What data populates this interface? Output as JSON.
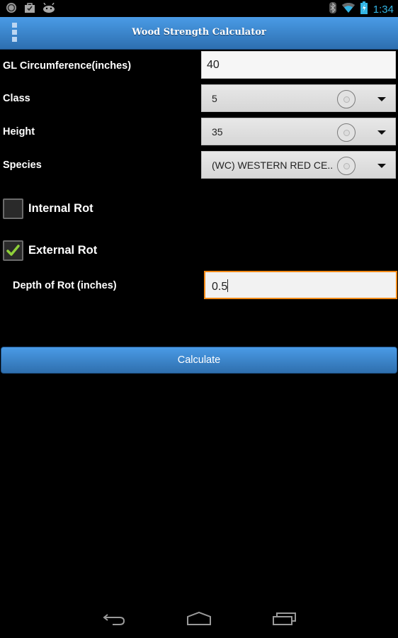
{
  "status_bar": {
    "left_icons": [
      "sync-icon",
      "store-bag-icon",
      "android-icon"
    ],
    "right_icons": [
      "bluetooth-icon",
      "wifi-icon",
      "battery-charging-icon"
    ],
    "time": "1:34",
    "time_color": "#33b5e5"
  },
  "action_bar": {
    "title": "Wood Strength Calculator",
    "menu_icon": "overflow-menu-icon",
    "accent": "#3d87d4"
  },
  "form": {
    "gl_circumference": {
      "label": "GL Circumference(inches)",
      "value": "40"
    },
    "class": {
      "label": "Class",
      "selected": "5"
    },
    "height": {
      "label": "Height",
      "selected": "35"
    },
    "species": {
      "label": "Species",
      "selected": "(WC) WESTERN RED CE.."
    },
    "internal_rot": {
      "label": "Internal Rot",
      "checked": false
    },
    "external_rot": {
      "label": "External Rot",
      "checked": true
    },
    "depth_of_rot": {
      "label": "Depth of Rot (inches)",
      "value": "0.5",
      "focus_color": "#f28a18"
    }
  },
  "calculate_button": {
    "label": "Calculate"
  },
  "nav_bar": {
    "back": "back-icon",
    "home": "home-icon",
    "recents": "recent-apps-icon"
  }
}
